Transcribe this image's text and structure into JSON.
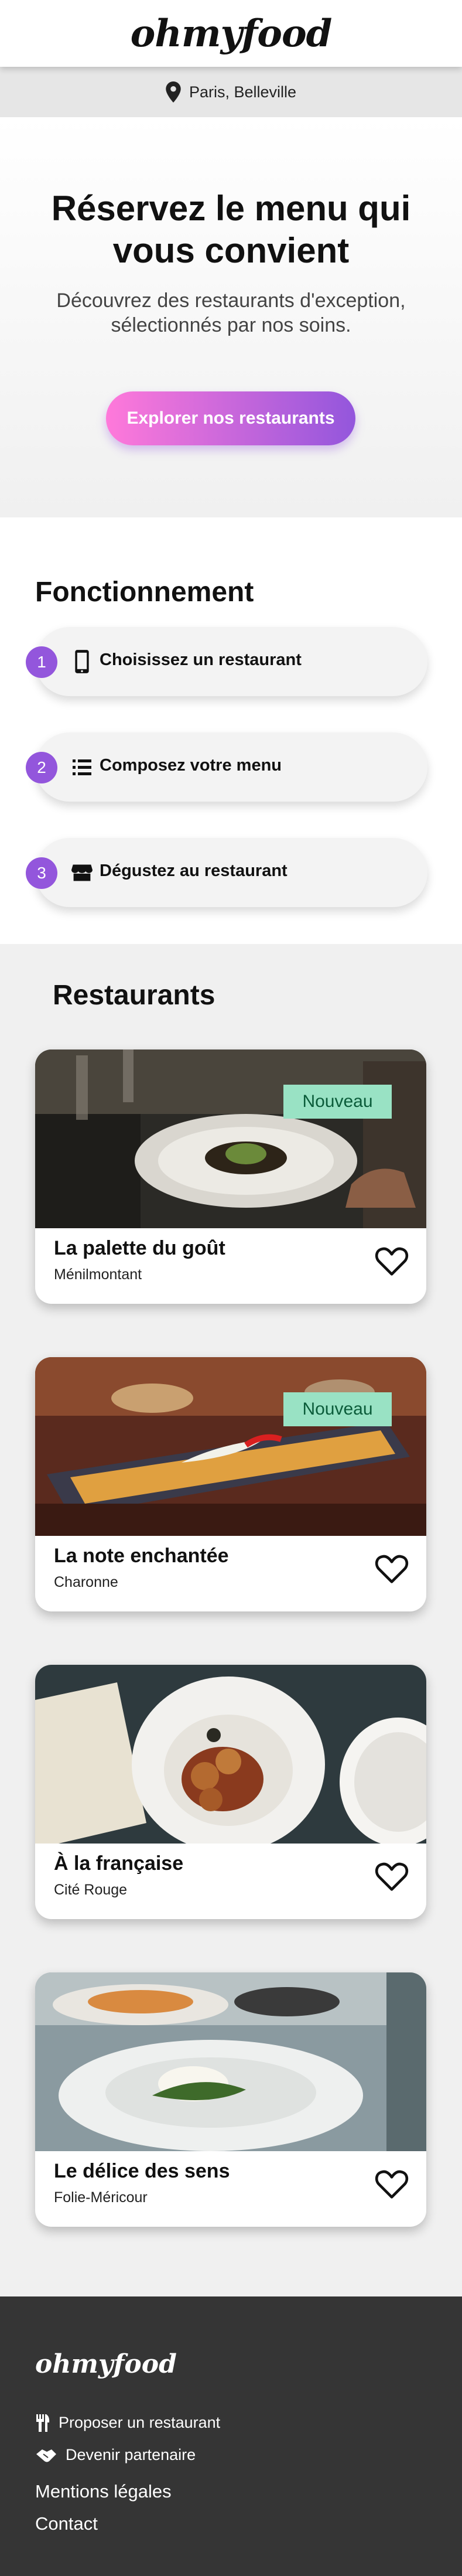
{
  "header": {
    "logo": "ohmyfood"
  },
  "location": {
    "label": "Paris, Belleville",
    "icon": "location-pin-icon"
  },
  "hero": {
    "title": "Réservez le menu qui vous convient",
    "subtitle": "Découvrez des restaurants d'exception, sélectionnés par nos soins.",
    "button": "Explorer nos restaurants"
  },
  "how": {
    "title": "Fonctionnement",
    "steps": [
      {
        "number": "1",
        "label": "Choisissez un restaurant",
        "icon": "mobile-phone-icon"
      },
      {
        "number": "2",
        "label": "Composez votre menu",
        "icon": "list-icon"
      },
      {
        "number": "3",
        "label": "Dégustez au restaurant",
        "icon": "store-icon"
      }
    ]
  },
  "restaurants": {
    "title": "Restaurants",
    "items": [
      {
        "name": "La palette du goût",
        "area": "Ménilmontant",
        "badge": "Nouveau"
      },
      {
        "name": "La note enchantée",
        "area": "Charonne",
        "badge": "Nouveau"
      },
      {
        "name": "À la française",
        "area": "Cité Rouge"
      },
      {
        "name": "Le délice des sens",
        "area": "Folie-Méricour"
      }
    ]
  },
  "footer": {
    "logo": "ohmyfood",
    "items": [
      {
        "label": "Proposer un restaurant",
        "icon": "utensils-icon"
      },
      {
        "label": "Devenir partenaire",
        "icon": "handshake-icon"
      }
    ],
    "links": [
      "Mentions légales",
      "Contact"
    ]
  },
  "colors": {
    "accent_purple": "#9356dc",
    "accent_pink": "#ff79da",
    "badge_green": "#99e2c4",
    "footer_bg": "#353535"
  }
}
